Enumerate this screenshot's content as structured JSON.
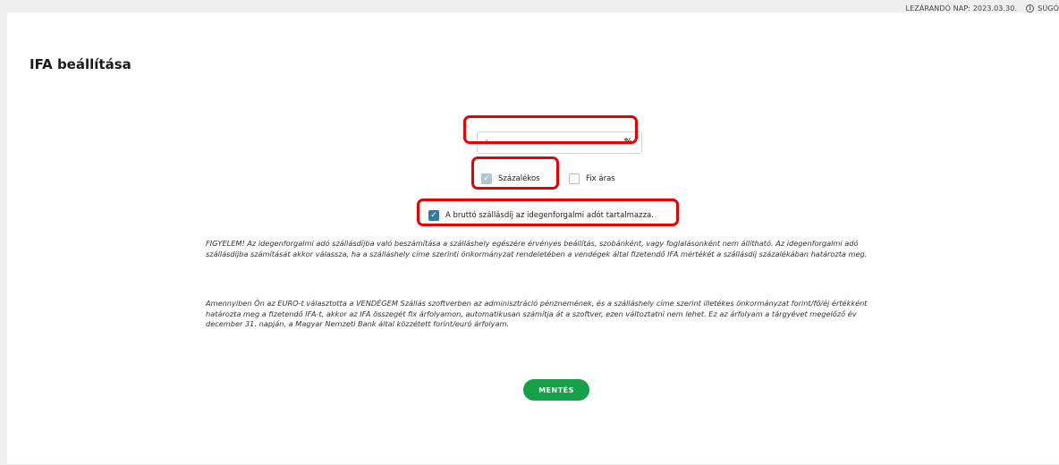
{
  "topbar": {
    "close_date": "LEZÁRANDÓ NAP: 2023.03.30.",
    "help_label": "SÚGÓ",
    "help_icon": "info-icon"
  },
  "page": {
    "title": "IFA beállítása"
  },
  "form": {
    "rate_value": "4",
    "rate_unit": "%",
    "percent_option": {
      "label": "Százalékos",
      "checked": true,
      "disabled": true
    },
    "fixed_option": {
      "label": "Fix áras",
      "checked": false
    },
    "gross_includes_tax": {
      "label": "A bruttó szállásdíj az idegenforgalmi adót tartalmazza.",
      "checked": true
    },
    "notice_1": "FIGYELEM! Az idegenforgalmi adó szállásdíjba való beszámítása a szálláshely egészére érvényes beállítás, szobánként, vagy foglalásonként nem állítható. Az idegenforgalmi adó szállásdíjba számítását akkor válassza, ha a szálláshely címe szerinti önkormányzat rendeletében a vendégek által fizetendő IFA mértékét a szállásdíj százalékában határozta meg.",
    "notice_2": "Amennyiben Ön az EURO-t választotta a VENDÉGEM Szállás szoftverben az adminisztráció pénznemének, és a szálláshely címe szerint illetékes önkormányzat forint/fő/éj értékként határozta meg a fizetendő IFA-t, akkor az IFA összegét fix árfolyamon, automatikusan számítja át a szoftver, ezen változtatni nem lehet. Ez az árfolyam a tárgyévet megelőző év december 31. napján, a Magyar Nemzeti Bank által közzétett forint/euró árfolyam.",
    "save_label": "MENTÉS"
  },
  "colors": {
    "highlight": "#e60000",
    "save_button": "#15a04a",
    "checkbox_checked": "#2f7f9a"
  }
}
